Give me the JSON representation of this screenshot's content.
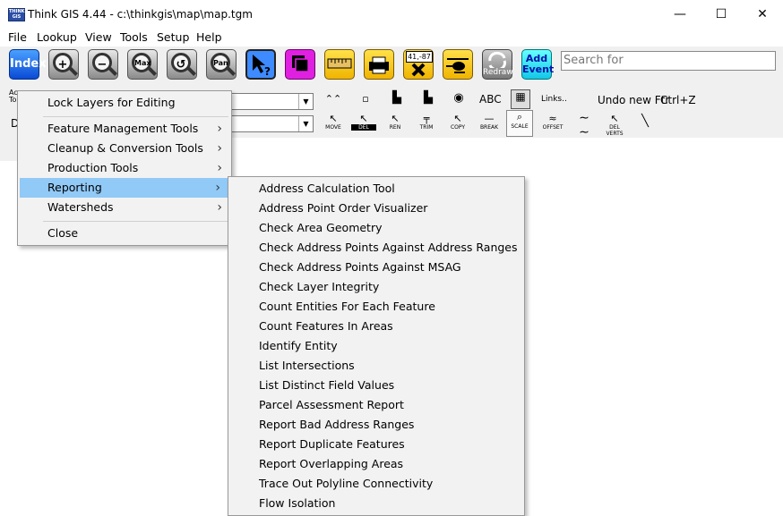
{
  "window": {
    "title": "Think GIS 4.44 - c:\\thinkgis\\map\\map.tgm",
    "icon_text": "THINK GIS",
    "controls": {
      "minimize": "—",
      "maximize": "☐",
      "close": "✕"
    }
  },
  "menubar": [
    "File",
    "Lookup",
    "View",
    "Tools",
    "Setup",
    "Help"
  ],
  "toolbar": {
    "index_label": "Index",
    "max_label": "Max",
    "pan_label": "Pan",
    "measure_text": "41,-87",
    "redraw_label": "Redraw",
    "add_event_line1": "Add",
    "add_event_line2": "Event",
    "search_placeholder": "Search for"
  },
  "edit_toolbar": {
    "left_label_1": "Ac",
    "left_label_2": "To",
    "combo2_text": "D",
    "abc_label": "ABC",
    "links_label": "Links..",
    "undo_label": "Undo new Ftr",
    "undo_shortcut": "Ctrl+Z",
    "tools": [
      "MOVE",
      "DEL",
      "REN",
      "TRIM",
      "COPY",
      "BREAK",
      "SCALE",
      "OFFSET",
      "DEL VERTS"
    ]
  },
  "context_menu": {
    "items": [
      {
        "label": "Lock Layers for Editing",
        "submenu": false
      },
      {
        "label": "Feature Management Tools",
        "submenu": true
      },
      {
        "label": "Cleanup & Conversion Tools",
        "submenu": true
      },
      {
        "label": "Production Tools",
        "submenu": true
      },
      {
        "label": "Reporting",
        "submenu": true,
        "highlighted": true
      },
      {
        "label": "Watersheds",
        "submenu": true
      },
      {
        "label": "Close",
        "submenu": false
      }
    ],
    "submenu_arrow": "›"
  },
  "reporting_submenu": [
    "Address Calculation Tool",
    "Address Point Order Visualizer",
    "Check Area Geometry",
    "Check Address Points Against Address Ranges",
    "Check Address Points Against MSAG",
    "Check Layer Integrity",
    "Count Entities For Each Feature",
    "Count Features In Areas",
    "Identify Entity",
    "List Intersections",
    "List Distinct Field Values",
    "Parcel Assessment Report",
    "Report Bad Address Ranges",
    "Report Duplicate Features",
    "Report Overlapping Areas",
    "Trace Out Polyline Connectivity",
    "Flow Isolation"
  ]
}
